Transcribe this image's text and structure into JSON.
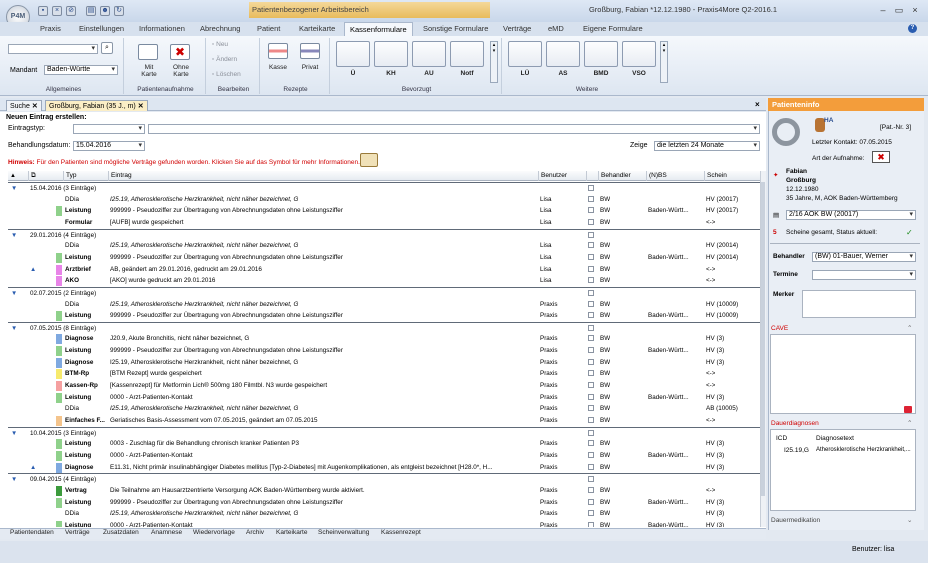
{
  "app": {
    "logo": "P4M",
    "context_tab": "Patientenbezogener Arbeitsbereich",
    "window_title": "Großburg, Fabian *12.12.1980 - Praxis4More Q2-2016.1"
  },
  "ribbon_tabs": [
    "Praxis",
    "Einstellungen",
    "Informationen",
    "Abrechnung",
    "Patient",
    "Karteikarte",
    "Kassenformulare",
    "Sonstige Formulare",
    "Verträge",
    "eMD",
    "Eigene Formulare"
  ],
  "ribbon": {
    "mandant_label": "Mandant",
    "mandant_value": "Baden-Württe",
    "allgemeines": "Allgemeines",
    "mit_karte": "Mit\nKarte",
    "ohne_karte": "Ohne\nKarte",
    "patientenaufnahme": "Patientenaufnahme",
    "neu": "Neu",
    "aendern": "Ändern",
    "loeschen": "Löschen",
    "bearbeiten": "Bearbeiten",
    "kasse": "Kasse",
    "privat": "Privat",
    "rezepte": "Rezepte",
    "bevorzugt_items": [
      "Ü",
      "KH",
      "AU",
      "Notf"
    ],
    "bevorzugt": "Bevorzugt",
    "weitere_items": [
      "LÜ",
      "AS",
      "BMD",
      "VSO"
    ],
    "weitere": "Weitere"
  },
  "doc_tabs": [
    "Suche",
    "Großburg, Fabian (35 J., m)"
  ],
  "form": {
    "title": "Neuen Eintrag erstellen:",
    "eintragstyp": "Eintragstyp:",
    "behandlungsdatum": "Behandlungsdatum:",
    "datum": "15.04.2016",
    "zeige": "Zeige",
    "zeige_value": "die letzten 24 Monate",
    "hinweis_label": "Hinweis:",
    "hinweis": "Für den Patienten sind mögliche Verträge gefunden worden. Klicken Sie auf das Symbol für mehr Informationen."
  },
  "columns": [
    "Typ",
    "Eintrag",
    "Benutzer",
    "Behandler",
    "(N)BS",
    "Schein"
  ],
  "rows": [
    {
      "g": "15.04.2016 (3 Einträge)"
    },
    {
      "t": "DDia",
      "e": "I25.19, Atherosklerotische Herzkrankheit, nicht näher bezeichnet, G",
      "u": "Lisa",
      "b": "BW",
      "s": "HV (20017)",
      "c": "",
      "i": 1
    },
    {
      "t": "Leistung",
      "e": "999999 - Pseudoziffer zur Übertragung von Abrechnungsdaten ohne Leistungsziffer",
      "u": "Lisa",
      "b": "BW",
      "n": "Baden-Württ...",
      "s": "HV (20017)",
      "c": "#8fd18b",
      "bo": 1
    },
    {
      "t": "Formular",
      "e": "[AUFB] wurde gespeichert",
      "u": "Lisa",
      "b": "BW",
      "s": "<->",
      "c": "#ffffff",
      "bo": 1
    },
    {
      "g": "29.01.2016 (4 Einträge)"
    },
    {
      "t": "DDia",
      "e": "I25.19, Atherosklerotische Herzkrankheit, nicht näher bezeichnet, G",
      "u": "Lisa",
      "b": "BW",
      "s": "HV (20014)",
      "c": "",
      "i": 1
    },
    {
      "t": "Leistung",
      "e": "999999 - Pseudoziffer zur Übertragung von Abrechnungsdaten ohne Leistungsziffer",
      "u": "Lisa",
      "b": "BW",
      "n": "Baden-Württ...",
      "s": "HV (20014)",
      "c": "#8fd18b",
      "bo": 1
    },
    {
      "t": "Arztbrief",
      "e": "AB, geändert am 29.01.2016, gedruckt am 29.01.2016",
      "u": "Lisa",
      "b": "BW",
      "s": "<->",
      "c": "#e884e8",
      "bo": 1,
      "a": 1
    },
    {
      "t": "AKO",
      "e": "[AKO] wurde gedruckt am 29.01.2016",
      "u": "Lisa",
      "b": "BW",
      "s": "<->",
      "c": "#e884e8",
      "bo": 1
    },
    {
      "g": "02.07.2015 (2 Einträge)"
    },
    {
      "t": "DDia",
      "e": "I25.19, Atherosklerotische Herzkrankheit, nicht näher bezeichnet, G",
      "u": "Praxis",
      "b": "BW",
      "s": "HV (10009)",
      "c": "",
      "i": 1
    },
    {
      "t": "Leistung",
      "e": "999999 - Pseudoziffer zur Übertragung von Abrechnungsdaten ohne Leistungsziffer",
      "u": "Praxis",
      "b": "BW",
      "n": "Baden-Württ...",
      "s": "HV (10009)",
      "c": "#8fd18b",
      "bo": 1
    },
    {
      "g": "07.05.2015 (8 Einträge)"
    },
    {
      "t": "Diagnose",
      "e": "J20.9, Akute Bronchitis, nicht näher bezeichnet, G",
      "u": "Praxis",
      "b": "BW",
      "s": "HV (3)",
      "c": "#7fa9e0",
      "bo": 1
    },
    {
      "t": "Leistung",
      "e": "999999 - Pseudoziffer zur Übertragung von Abrechnungsdaten ohne Leistungsziffer",
      "u": "Praxis",
      "b": "BW",
      "n": "Baden-Württ...",
      "s": "HV (3)",
      "c": "#8fd18b",
      "bo": 1
    },
    {
      "t": "Diagnose",
      "e": "I25.19, Atherosklerotische Herzkrankheit, nicht näher bezeichnet, G",
      "u": "Praxis",
      "b": "BW",
      "s": "HV (3)",
      "c": "#7fa9e0",
      "bo": 1
    },
    {
      "t": "BTM-Rp",
      "e": "[BTM Rezept] wurde gespeichert",
      "u": "Praxis",
      "b": "BW",
      "s": "<->",
      "c": "#f7ea6d",
      "bo": 1
    },
    {
      "t": "Kassen-Rp",
      "e": "[Kassenrezept] für Metformin Lich® 500mg 180 Filmtbl. N3 wurde gespeichert",
      "u": "Praxis",
      "b": "BW",
      "s": "<->",
      "c": "#f5a0a0",
      "bo": 1
    },
    {
      "t": "Leistung",
      "e": "0000 - Arzt-Patienten-Kontakt",
      "u": "Praxis",
      "b": "BW",
      "n": "Baden-Württ...",
      "s": "HV (3)",
      "c": "#8fd18b",
      "bo": 1
    },
    {
      "t": "DDia",
      "e": "I25.19, Atherosklerotische Herzkrankheit, nicht näher bezeichnet, G",
      "u": "Praxis",
      "b": "BW",
      "s": "AB (10005)",
      "c": "",
      "i": 1
    },
    {
      "t": "Einfaches F...",
      "e": "Geriatisches Basis-Assessment vom 07.05.2015, geändert am 07.05.2015",
      "u": "Praxis",
      "b": "BW",
      "s": "<->",
      "c": "#f4c48c",
      "bo": 1
    },
    {
      "g": "10.04.2015 (3 Einträge)"
    },
    {
      "t": "Leistung",
      "e": "0003 - Zuschlag für die Behandlung chronisch kranker Patienten P3",
      "u": "Praxis",
      "b": "BW",
      "s": "HV (3)",
      "c": "#8fd18b",
      "bo": 1
    },
    {
      "t": "Leistung",
      "e": "0000 - Arzt-Patienten-Kontakt",
      "u": "Praxis",
      "b": "BW",
      "n": "Baden-Württ...",
      "s": "HV (3)",
      "c": "#8fd18b",
      "bo": 1
    },
    {
      "t": "Diagnose",
      "e": "E11.31, Nicht primär insulinabhängiger Diabetes mellitus [Typ-2-Diabetes] mit Augenkomplikationen, als entgleist bezeichnet [H28.0*, H...",
      "u": "Praxis",
      "b": "BW",
      "s": "HV (3)",
      "c": "#7fa9e0",
      "bo": 1,
      "a": 1
    },
    {
      "g": "09.04.2015 (4 Einträge)"
    },
    {
      "t": "Vertrag",
      "e": "Die Teilnahme am Hausarztzentrierte Versorgung AOK Baden-Württemberg wurde aktiviert.",
      "u": "Praxis",
      "b": "BW",
      "s": "<->",
      "c": "#3c9b3c",
      "bo": 1
    },
    {
      "t": "Leistung",
      "e": "999999 - Pseudoziffer zur Übertragung von Abrechnungsdaten ohne Leistungsziffer",
      "u": "Praxis",
      "b": "BW",
      "n": "Baden-Württ...",
      "s": "HV (3)",
      "c": "#8fd18b",
      "bo": 1
    },
    {
      "t": "DDia",
      "e": "I25.19, Atherosklerotische Herzkrankheit, nicht näher bezeichnet, G",
      "u": "Praxis",
      "b": "BW",
      "s": "HV (3)",
      "c": "",
      "i": 1
    },
    {
      "t": "Leistung",
      "e": "0000 - Arzt-Patienten-Kontakt",
      "u": "Praxis",
      "b": "BW",
      "n": "Baden-Württ...",
      "s": "HV (3)",
      "c": "#8fd18b",
      "bo": 1
    }
  ],
  "bottom_tabs": [
    "Patientendaten",
    "Verträge",
    "Zusatzdaten",
    "Anamnese",
    "Wiedervorlage",
    "Archiv",
    "Karteikarte",
    "Scheinverwaltung",
    "Kassenrezept"
  ],
  "side": {
    "title": "Patienteninfo",
    "ha": "HA",
    "pat_nr": "[Pat.-Nr. 3]",
    "letzter_kontakt": "Letzter Kontakt: 07.05.2015",
    "art_aufnahme": "Art der Aufnahme:",
    "vorname": "Fabian",
    "nachname": "Großburg",
    "geb": "12.12.1980",
    "info": "35 Jahre, M, AOK Baden-Württemberg",
    "schein": "2/16 AOK BW (20017)",
    "scheine_count": "5",
    "scheine_text": "Scheine gesamt, Status aktuell:",
    "behandler_label": "Behandler",
    "behandler_value": "(BW) 01-Bauer, Werner",
    "termine_label": "Termine",
    "merker_label": "Merker",
    "cave": "CAVE",
    "dauerdiagnosen": "Dauerdiagnosen",
    "icd": "ICD",
    "diagnosetext": "Diagnosetext",
    "dd_icd": "I25.19,G",
    "dd_text": "Atherosklerotische Herzkrankheit,...",
    "dauermedikation": "Dauermedikation"
  },
  "status": "Benutzer: lisa"
}
